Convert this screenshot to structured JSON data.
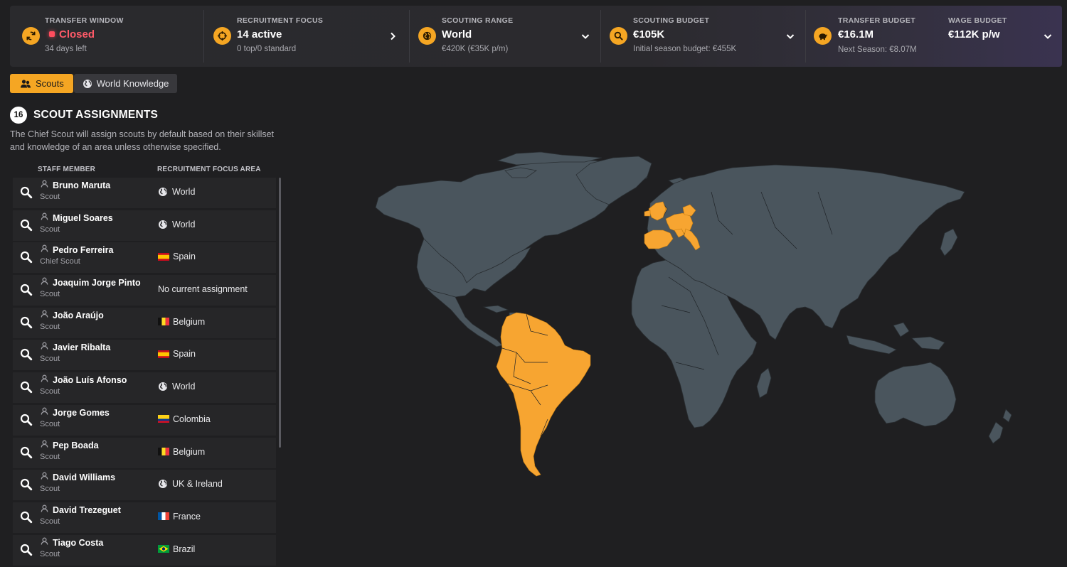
{
  "header": {
    "transfer_window": {
      "label": "TRANSFER WINDOW",
      "value": "Closed",
      "sub": "34 days left",
      "icon": "refresh-icon"
    },
    "recruitment_focus": {
      "label": "RECRUITMENT FOCUS",
      "value": "14 active",
      "sub": "0 top/0 standard",
      "icon": "crosshair-icon"
    },
    "scouting_range": {
      "label": "SCOUTING RANGE",
      "value": "World",
      "sub": "€420K (€35K p/m)",
      "icon": "globe-icon"
    },
    "scouting_budget": {
      "label": "SCOUTING BUDGET",
      "value": "€105K",
      "sub": "Initial season budget: €455K",
      "icon": "search-icon"
    },
    "transfer_budget": {
      "label": "TRANSFER BUDGET",
      "value": "€16.1M",
      "sub": "Next Season: €8.07M",
      "icon": "piggy-bank-icon"
    },
    "wage_budget": {
      "label": "WAGE BUDGET",
      "value": "€112K p/w"
    }
  },
  "tabs": [
    {
      "label": "Scouts",
      "active": true
    },
    {
      "label": "World Knowledge",
      "active": false
    }
  ],
  "section": {
    "count": "16",
    "title": "SCOUT ASSIGNMENTS",
    "description": "The Chief Scout will assign scouts by default based on their skillset and knowledge of an area unless otherwise specified."
  },
  "columns": {
    "staff": "STAFF MEMBER",
    "area": "RECRUITMENT FOCUS AREA"
  },
  "scouts": [
    {
      "name": "Bruno Maruta",
      "role": "Scout",
      "area": "World",
      "icon": "globe"
    },
    {
      "name": "Miguel Soares",
      "role": "Scout",
      "area": "World",
      "icon": "globe"
    },
    {
      "name": "Pedro Ferreira",
      "role": "Chief Scout",
      "area": "Spain",
      "icon": "flag-es"
    },
    {
      "name": "Joaquim Jorge Pinto",
      "role": "Scout",
      "area": "No current assignment",
      "icon": "none"
    },
    {
      "name": "João Araújo",
      "role": "Scout",
      "area": "Belgium",
      "icon": "flag-be"
    },
    {
      "name": "Javier Ribalta",
      "role": "Scout",
      "area": "Spain",
      "icon": "flag-es"
    },
    {
      "name": "João Luís Afonso",
      "role": "Scout",
      "area": "World",
      "icon": "globe"
    },
    {
      "name": "Jorge Gomes",
      "role": "Scout",
      "area": "Colombia",
      "icon": "flag-co"
    },
    {
      "name": "Pep Boada",
      "role": "Scout",
      "area": "Belgium",
      "icon": "flag-be"
    },
    {
      "name": "David Williams",
      "role": "Scout",
      "area": "UK & Ireland",
      "icon": "globe"
    },
    {
      "name": "David Trezeguet",
      "role": "Scout",
      "area": "France",
      "icon": "flag-fr"
    },
    {
      "name": "Tiago Costa",
      "role": "Scout",
      "area": "Brazil",
      "icon": "flag-br"
    }
  ],
  "map": {
    "land_color": "#4a555d",
    "highlight_color": "#f7a531",
    "highlighted_regions": [
      "Europe (West)",
      "South America"
    ]
  }
}
